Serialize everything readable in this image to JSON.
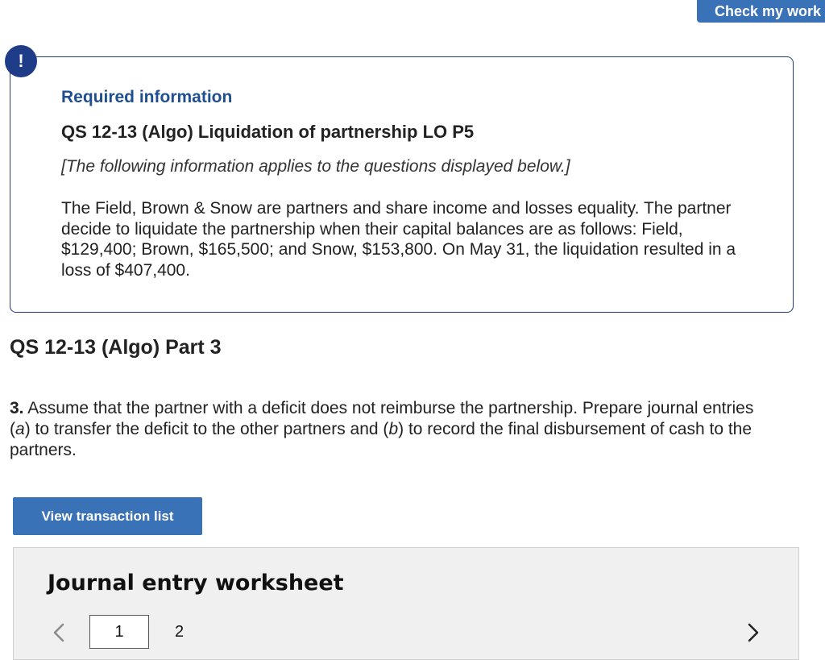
{
  "header": {
    "check_button_label": "Check my work"
  },
  "info": {
    "alert_symbol": "!",
    "label": "Required information",
    "title": "QS 12-13 (Algo) Liquidation of partnership LO P5",
    "note": "[The following information applies to the questions displayed below.]",
    "body": "The Field, Brown & Snow are partners and share income and losses equality. The partner decide to liquidate the partnership when their capital balances are as follows: Field, $129,400; Brown, $165,500; and Snow, $153,800. On May 31, the liquidation resulted in a loss of $407,400."
  },
  "part": {
    "title": "QS 12-13 (Algo) Part 3"
  },
  "question": {
    "number": "3.",
    "line1": "Assume that the partner with a deficit does not reimburse the partnership. Prepare journal entries",
    "line2_a_pre": "(",
    "line2_a": "a",
    "line2_mid": ") to transfer the deficit to the other partners and (",
    "line2_b": "b",
    "line2_post": ") to record the final disbursement of cash to the",
    "line3": "partners."
  },
  "actions": {
    "view_transaction_list_label": "View transaction list"
  },
  "worksheet": {
    "title": "Journal entry worksheet",
    "pages": [
      "1",
      "2"
    ],
    "current_page": "1"
  },
  "colors": {
    "accent": "#3a72b8",
    "info_border": "#1f3f74",
    "info_label": "#1f4e91",
    "alert": "#1f3c88",
    "worksheet_bg": "#f0f0f0"
  },
  "icons": {
    "alert": "exclamation-icon",
    "prev": "chevron-left-icon",
    "next": "chevron-right-icon"
  }
}
